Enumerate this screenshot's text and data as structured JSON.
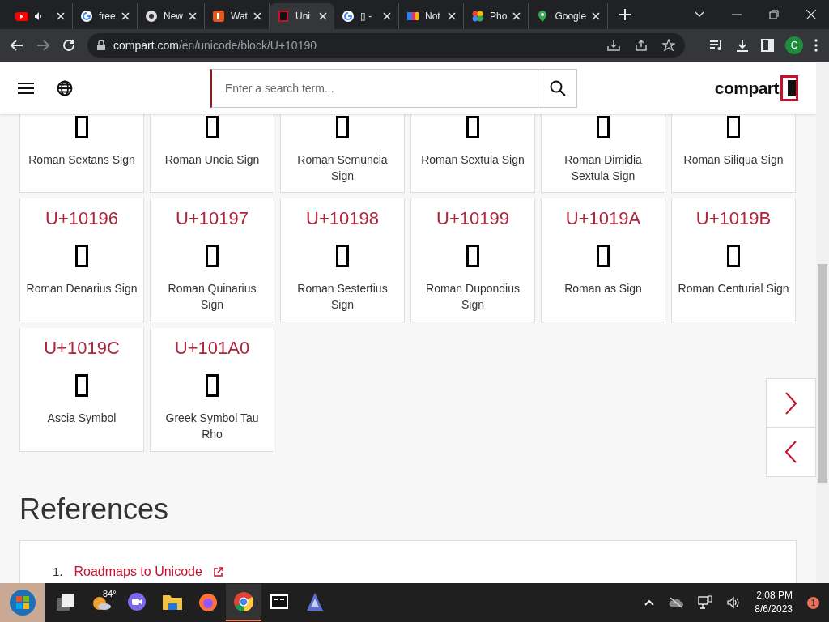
{
  "tabs": [
    {
      "audio": true,
      "selected": false
    },
    {
      "title": "free",
      "selected": false
    },
    {
      "title": "New",
      "selected": false
    },
    {
      "title": "Wat",
      "selected": false
    },
    {
      "title": "Uni",
      "selected": true
    },
    {
      "title": "▯ -",
      "selected": false
    },
    {
      "title": "Not",
      "selected": false
    },
    {
      "title": "Pho",
      "selected": false
    },
    {
      "title": "Google",
      "selected": false
    }
  ],
  "address": {
    "host": "compart.com",
    "path": "/en/unicode/block/U+10190"
  },
  "profile": "C",
  "search": {
    "placeholder": "Enter a search term..."
  },
  "logo": "compart",
  "cards": [
    {
      "name": "Roman Sextans Sign"
    },
    {
      "name": "Roman Uncia Sign"
    },
    {
      "name": "Roman Semuncia Sign"
    },
    {
      "name": "Roman Sextula Sign"
    },
    {
      "name": "Roman Dimidia Sextula Sign"
    },
    {
      "name": "Roman Siliqua Sign"
    },
    {
      "code": "U+10196",
      "name": "Roman Denarius Sign"
    },
    {
      "code": "U+10197",
      "name": "Roman Quinarius Sign"
    },
    {
      "code": "U+10198",
      "name": "Roman Sestertius Sign"
    },
    {
      "code": "U+10199",
      "name": "Roman Dupondius Sign"
    },
    {
      "code": "U+1019A",
      "name": "Roman as Sign"
    },
    {
      "code": "U+1019B",
      "name": "Roman Centurial Sign"
    },
    {
      "code": "U+1019C",
      "name": "Ascia Symbol"
    },
    {
      "code": "U+101A0",
      "name": "Greek Symbol Tau Rho"
    }
  ],
  "references": {
    "heading": "References",
    "items": [
      {
        "number": "1.",
        "text": "Roadmaps to Unicode"
      }
    ]
  },
  "taskbar": {
    "weather": "84°",
    "apps": [
      {
        "kind": "taskview",
        "active": false
      },
      {
        "kind": "weather",
        "active": false
      },
      {
        "kind": "meet",
        "active": false
      },
      {
        "kind": "explorer",
        "active": false
      },
      {
        "kind": "firefox",
        "active": false
      },
      {
        "kind": "chrome",
        "active": true
      },
      {
        "kind": "archive",
        "active": false
      },
      {
        "kind": "app",
        "active": false
      }
    ],
    "time": "2:08 PM",
    "date": "8/6/2023",
    "notifications": "1"
  }
}
